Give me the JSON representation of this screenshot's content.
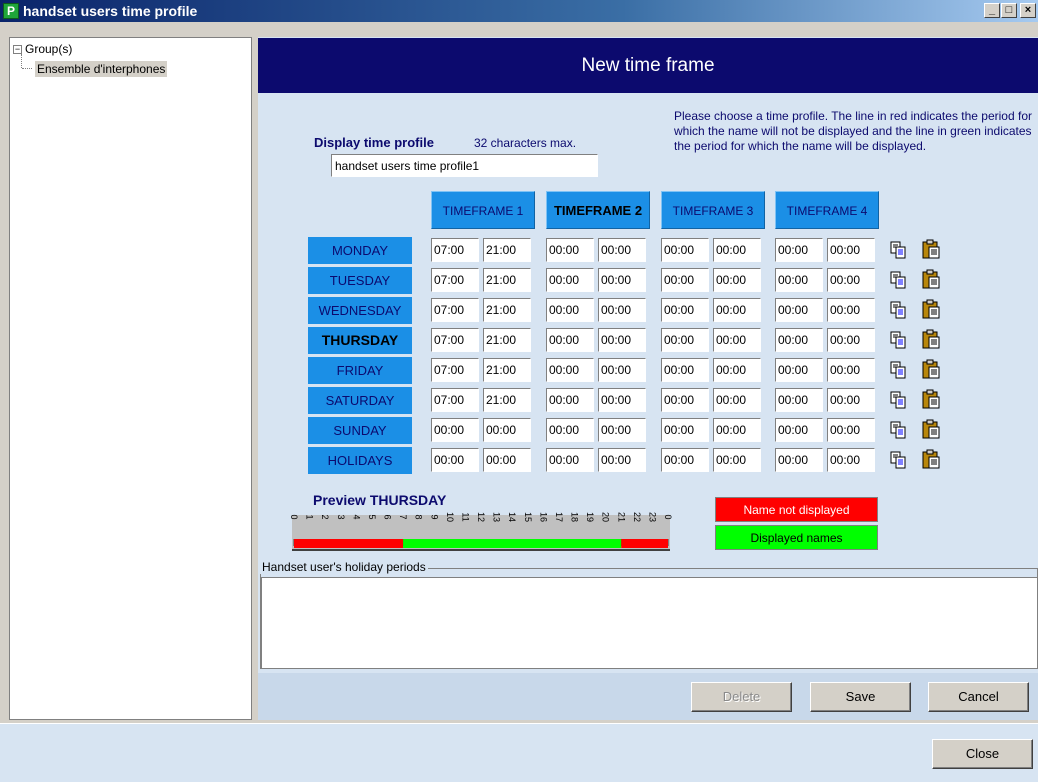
{
  "window": {
    "title": "handset users time profile",
    "icon_letter": "P",
    "controls": [
      "_",
      "□",
      "×"
    ]
  },
  "tree": {
    "root_label": "Group(s)",
    "root_expander": "−",
    "child_label": "Ensemble d'interphones"
  },
  "header": {
    "title": "New time frame"
  },
  "profile": {
    "label": "Display time profile",
    "hint": "32 characters max.",
    "value": "handset users time profile1"
  },
  "instruction": "Please choose a time profile. The line in red indicates the period for which the name will not be displayed and the line in green indicates the period for which the name will be displayed.",
  "timeframes": [
    "TIMEFRAME 1",
    "TIMEFRAME 2",
    "TIMEFRAME 3",
    "TIMEFRAME 4"
  ],
  "days": [
    {
      "label": "MONDAY",
      "times": [
        "07:00",
        "21:00",
        "00:00",
        "00:00",
        "00:00",
        "00:00",
        "00:00",
        "00:00"
      ]
    },
    {
      "label": "TUESDAY",
      "times": [
        "07:00",
        "21:00",
        "00:00",
        "00:00",
        "00:00",
        "00:00",
        "00:00",
        "00:00"
      ]
    },
    {
      "label": "WEDNESDAY",
      "times": [
        "07:00",
        "21:00",
        "00:00",
        "00:00",
        "00:00",
        "00:00",
        "00:00",
        "00:00"
      ]
    },
    {
      "label": "THURSDAY",
      "times": [
        "07:00",
        "21:00",
        "00:00",
        "00:00",
        "00:00",
        "00:00",
        "00:00",
        "00:00"
      ]
    },
    {
      "label": "FRIDAY",
      "times": [
        "07:00",
        "21:00",
        "00:00",
        "00:00",
        "00:00",
        "00:00",
        "00:00",
        "00:00"
      ]
    },
    {
      "label": "SATURDAY",
      "times": [
        "07:00",
        "21:00",
        "00:00",
        "00:00",
        "00:00",
        "00:00",
        "00:00",
        "00:00"
      ]
    },
    {
      "label": "SUNDAY",
      "times": [
        "00:00",
        "00:00",
        "00:00",
        "00:00",
        "00:00",
        "00:00",
        "00:00",
        "00:00"
      ]
    },
    {
      "label": "HOLIDAYS",
      "times": [
        "00:00",
        "00:00",
        "00:00",
        "00:00",
        "00:00",
        "00:00",
        "00:00",
        "00:00"
      ]
    }
  ],
  "selected_day": "THURSDAY",
  "active_timeframe": "TIMEFRAME 2",
  "row_icons": [
    "copy-icon",
    "paste-icon"
  ],
  "preview": {
    "title": "Preview THURSDAY",
    "hours": [
      "0",
      "1",
      "2",
      "3",
      "4",
      "5",
      "6",
      "7",
      "8",
      "9",
      "10",
      "11",
      "12",
      "13",
      "14",
      "15",
      "16",
      "17",
      "18",
      "19",
      "20",
      "21",
      "22",
      "23",
      "0"
    ],
    "displayed_from": 7,
    "displayed_to": 21
  },
  "legend": {
    "not_displayed": "Name not displayed",
    "displayed": "Displayed names",
    "colors": {
      "not_displayed": "#ff0000",
      "displayed": "#00ff00"
    }
  },
  "holiday": {
    "legend": "Handset user's holiday periods"
  },
  "buttons": {
    "delete": "Delete",
    "save": "Save",
    "cancel": "Cancel",
    "close": "Close"
  },
  "colors": {
    "header_bg": "#0c0a6e",
    "accent_blue": "#1b8fe6",
    "panel_bg": "#d7e4f2"
  }
}
